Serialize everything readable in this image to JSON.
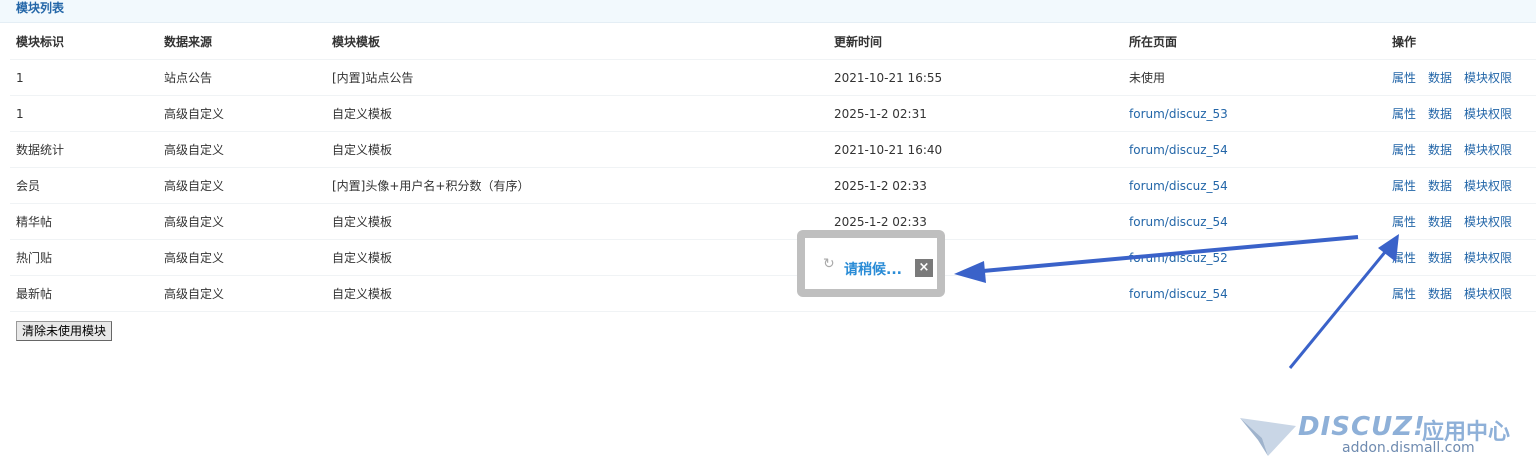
{
  "section": {
    "title": "模块列表"
  },
  "table": {
    "headers": [
      "模块标识",
      "数据来源",
      "模块模板",
      "更新时间",
      "所在页面",
      "操作"
    ],
    "rows": [
      {
        "id": "1",
        "source": "站点公告",
        "template": "[内置]站点公告",
        "updated": "2021-10-21 16:55",
        "page": "未使用",
        "page_is_link": false
      },
      {
        "id": "1",
        "source": "高级自定义",
        "template": "自定义模板",
        "updated": "2025-1-2 02:31",
        "page": "forum/discuz_53",
        "page_is_link": true
      },
      {
        "id": "数据统计",
        "source": "高级自定义",
        "template": "自定义模板",
        "updated": "2021-10-21 16:40",
        "page": "forum/discuz_54",
        "page_is_link": true
      },
      {
        "id": "会员",
        "source": "高级自定义",
        "template": "[内置]头像+用户名+积分数（有序）",
        "updated": "2025-1-2 02:33",
        "page": "forum/discuz_54",
        "page_is_link": true
      },
      {
        "id": "精华帖",
        "source": "高级自定义",
        "template": "自定义模板",
        "updated": "2025-1-2 02:33",
        "page": "forum/discuz_54",
        "page_is_link": true
      },
      {
        "id": "热门贴",
        "source": "高级自定义",
        "template": "自定义模板",
        "updated": "",
        "page": "forum/discuz_52",
        "page_is_link": true
      },
      {
        "id": "最新帖",
        "source": "高级自定义",
        "template": "自定义模板",
        "updated": "",
        "page": "forum/discuz_54",
        "page_is_link": true
      }
    ],
    "actions": [
      "属性",
      "数据",
      "模块权限"
    ]
  },
  "buttons": {
    "clear_unused": "清除未使用模块"
  },
  "loading": {
    "text": "请稍候...",
    "close_glyph": "×",
    "spinner_icon": "refresh-icon"
  },
  "watermark": {
    "brand": "DISCUZ!",
    "brand_cn": "应用中心",
    "url": "addon.dismall.com"
  },
  "colors": {
    "link": "#2366a8",
    "header_bg": "#f2f9fd",
    "annotation_arrow": "#3a62c9"
  }
}
